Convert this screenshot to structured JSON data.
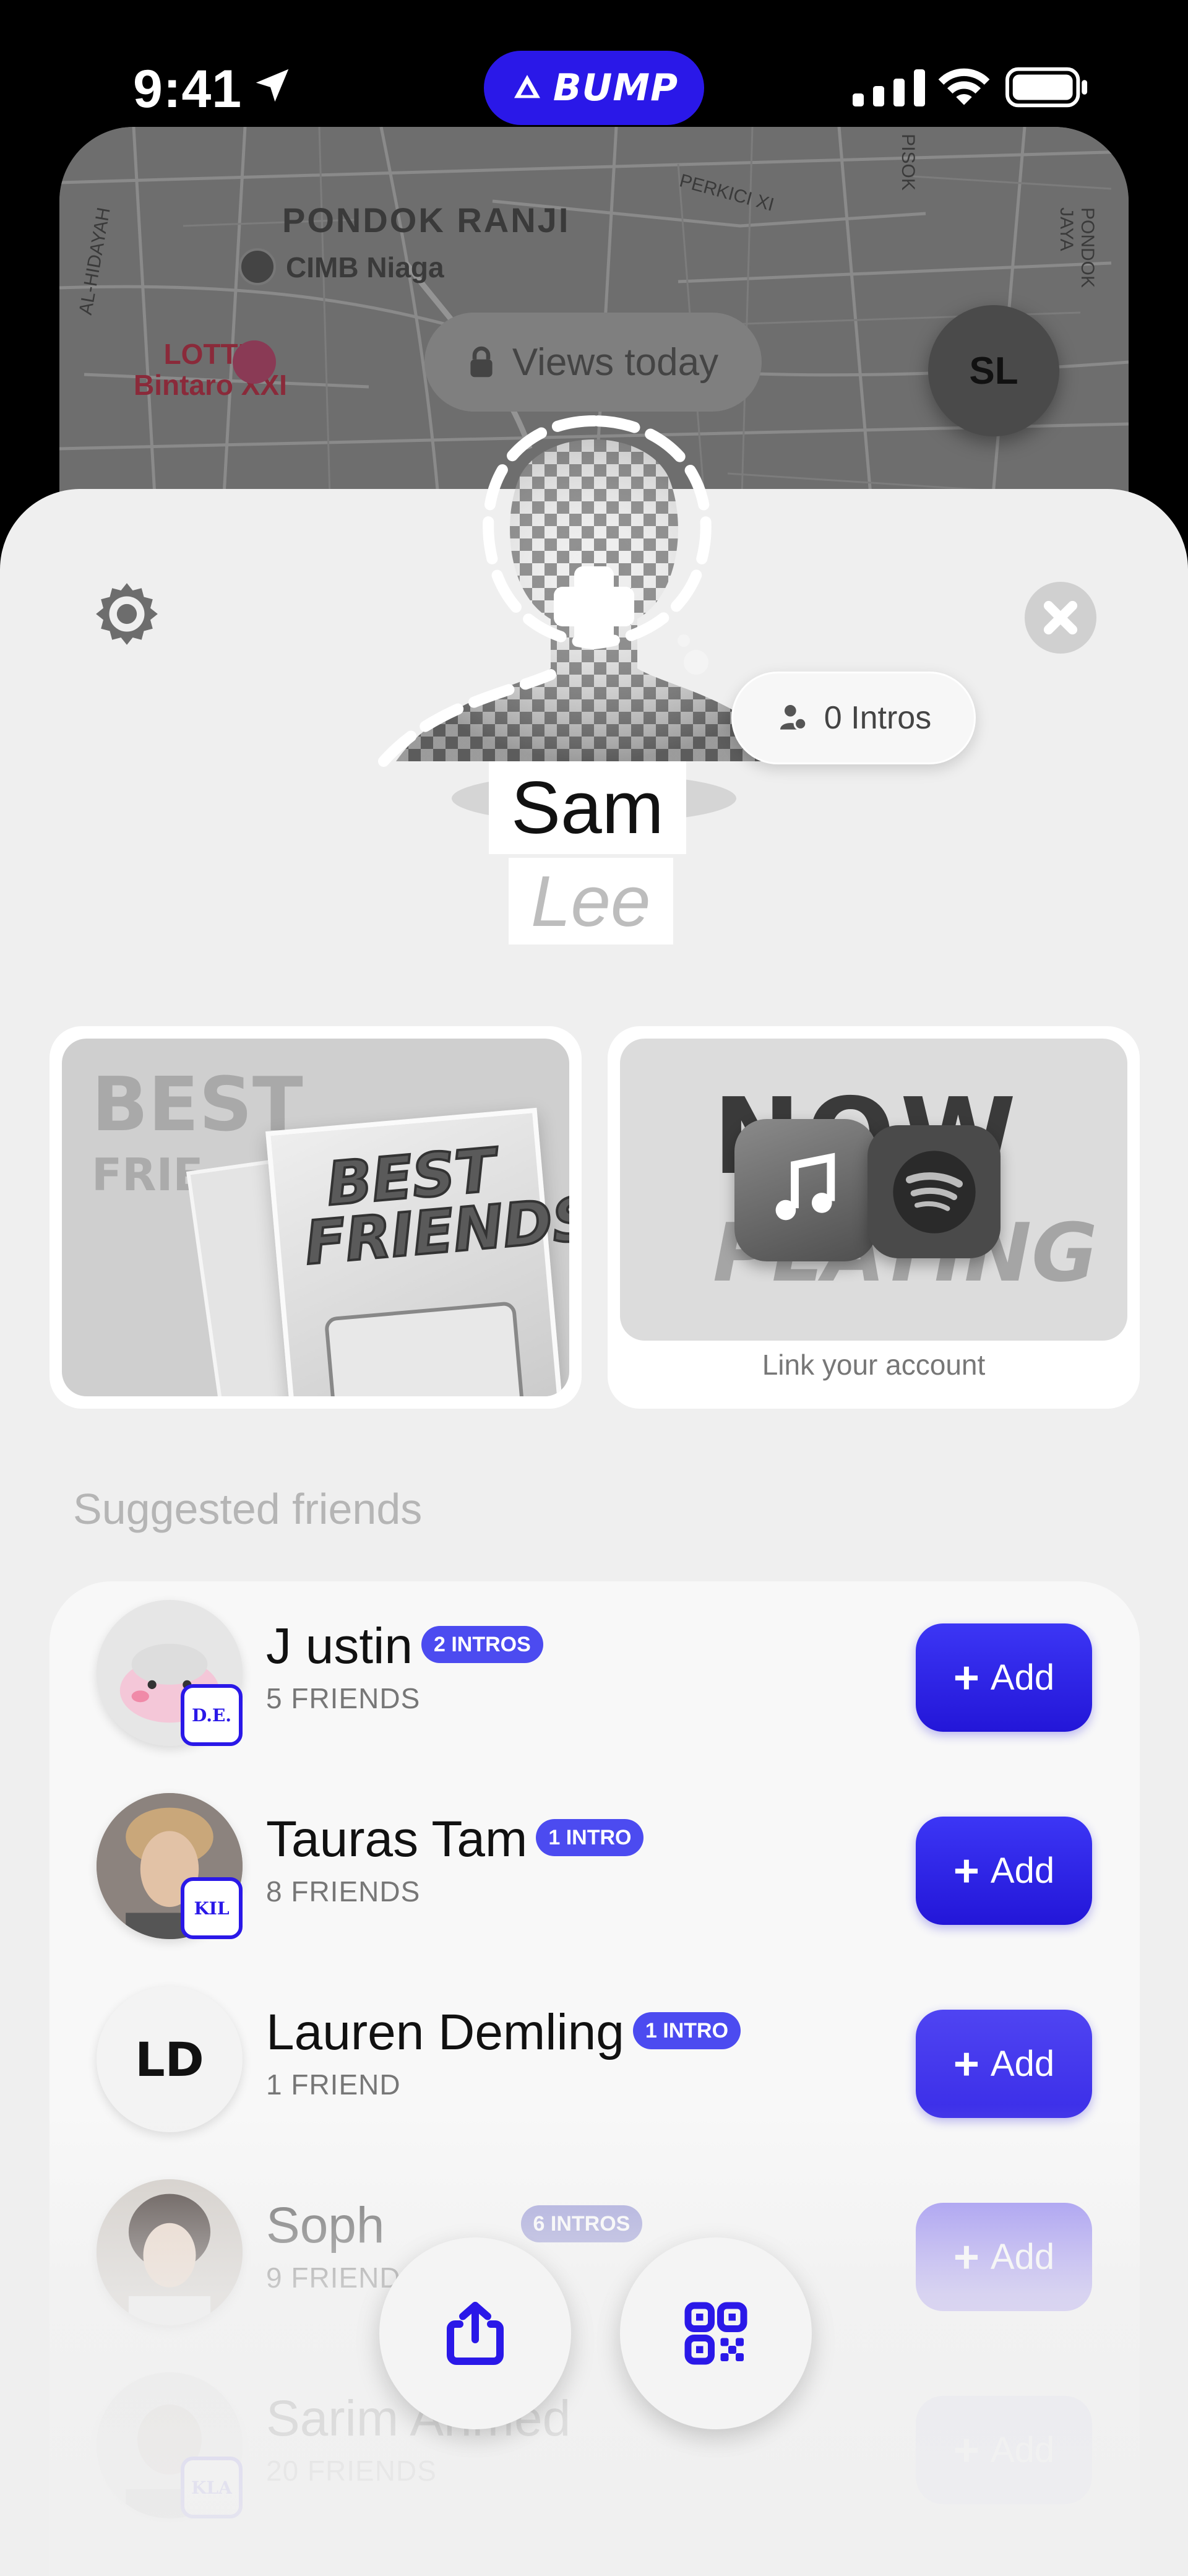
{
  "status_bar": {
    "time": "9:41",
    "app_pill_label": "BUMP",
    "accent_color": "#2a18e8"
  },
  "map": {
    "labels": {
      "area_name": "PONDOK RANJI",
      "bank": "CIMB Niaga",
      "cinema": "LOTTE\nBintaro XXI",
      "street_1": "PERKICI XI",
      "street_2": "PISOK",
      "street_3": "PONDOK JAYA",
      "street_4": "AL-HIDAYAH"
    },
    "views_pill": "Views today",
    "avatar_initials": "SL"
  },
  "profile": {
    "first_name": "Sam",
    "last_name": "Lee",
    "intros_label": "0 Intros"
  },
  "cards": {
    "best_friends": {
      "watermark": "BEST",
      "watermark_2": "FRIE",
      "card_title": "BEST FRIENDS"
    },
    "now_playing": {
      "word_1": "NOW",
      "word_2": "PLAYING",
      "caption": "Link your account"
    }
  },
  "suggested": {
    "title": "Suggested friends",
    "add_label": "Add",
    "friends": [
      {
        "name": "J ustin",
        "tag": "2 INTROS",
        "sub": "5 FRIENDS",
        "badge": "D.E."
      },
      {
        "name": "Tauras Tam",
        "tag": "1 INTRO",
        "sub": "8 FRIENDS",
        "badge": "KIL"
      },
      {
        "name": "Lauren Demling",
        "tag": "1 INTRO",
        "sub": "1 FRIEND",
        "initials": "LD"
      },
      {
        "name": "Soph",
        "tag": "6 INTROS",
        "sub": "9 FRIENDS"
      },
      {
        "name": "Sarim Ahmed",
        "sub": "20 FRIENDS",
        "badge": "KLA"
      }
    ]
  }
}
